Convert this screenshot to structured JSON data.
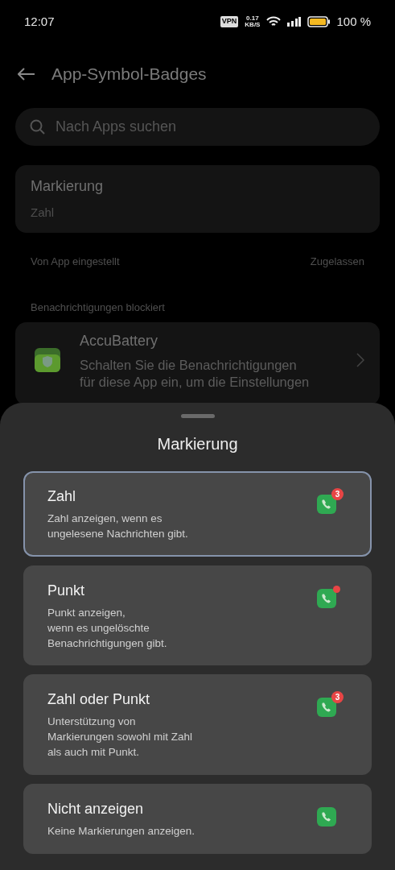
{
  "status_bar": {
    "time": "12:07",
    "vpn": "VPN",
    "speed": "0.17",
    "speed_unit": "KB/S",
    "battery": "100 %"
  },
  "header": {
    "title": "App-Symbol-Badges"
  },
  "search": {
    "placeholder": "Nach Apps suchen"
  },
  "setting": {
    "label": "Markierung",
    "value": "Zahl"
  },
  "section": {
    "label": "Von App eingestellt",
    "value": "Zugelassen"
  },
  "blocked": {
    "label": "Benachrichtigungen blockiert",
    "apps": [
      {
        "name": "AccuBattery",
        "description": "Schalten Sie die Benachrichtigungen\nfür diese App ein, um die Einstellungen"
      }
    ]
  },
  "sheet": {
    "title": "Markierung",
    "options": [
      {
        "title": "Zahl",
        "description": "Zahl anzeigen, wenn es\nungelesene Nachrichten gibt.",
        "selected": true,
        "kind": "count",
        "badge": "3"
      },
      {
        "title": "Punkt",
        "description": "Punkt anzeigen,\nwenn es ungelöschte\nBenachrichtigungen gibt.",
        "selected": false,
        "kind": "dot"
      },
      {
        "title": "Zahl oder Punkt",
        "description": "Unterstützung von\nMarkierungen sowohl mit Zahl\nals auch mit Punkt.",
        "selected": false,
        "kind": "count",
        "badge": "3"
      },
      {
        "title": "Nicht anzeigen",
        "description": "Keine Markierungen anzeigen.",
        "selected": false,
        "kind": "none"
      }
    ]
  }
}
